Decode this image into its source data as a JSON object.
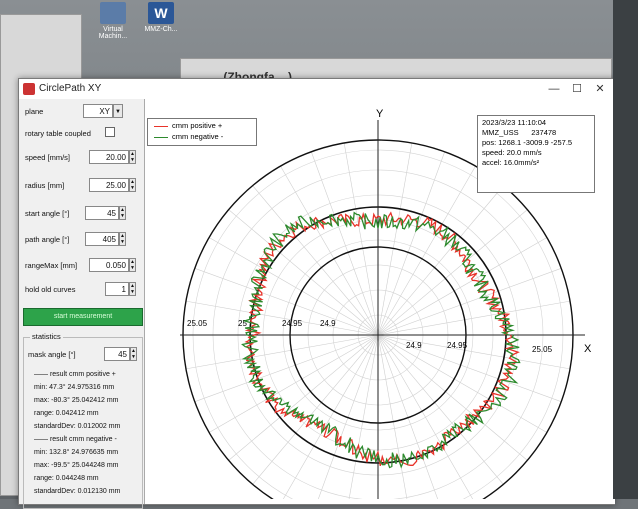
{
  "desktop": {
    "icons": [
      {
        "name": "Virtual Machin...",
        "color": "#5b7ca8"
      },
      {
        "name": "MMZ-Ch...",
        "color": "#2b5797"
      }
    ],
    "background_title": "... (Zhongfa ...)"
  },
  "window": {
    "title": "CirclePath XY",
    "minimize": "—",
    "maximize": "☐",
    "close": "✕"
  },
  "controls": {
    "plane_label": "plane",
    "plane_value": "XY",
    "rotary_label": "rotary table coupled",
    "speed_label": "speed [mm/s]",
    "speed_value": "20.00",
    "radius_label": "radius [mm]",
    "radius_value": "25.00",
    "start_angle_label": "start angle [°]",
    "start_angle_value": "45",
    "path_angle_label": "path angle [°]",
    "path_angle_value": "405",
    "range_max_label": "rangeMax [mm]",
    "range_max_value": "0.050",
    "hold_label": "hold old curves",
    "hold_value": "1",
    "start_button": "start measurement"
  },
  "statistics": {
    "title": "statistics",
    "mask_angle_label": "mask angle [°]",
    "mask_angle_value": "45",
    "positive_header": "—— result cmm positive +",
    "pos_min": "min: 47.3°   24.975316 mm",
    "pos_max": "max: -80.3°   25.042412 mm",
    "pos_range": "range: 0.042412 mm",
    "pos_std": "standardDev: 0.012002 mm",
    "negative_header": "—— result cmm negative -",
    "neg_min": "min: 132.8°   24.976635 mm",
    "neg_max": "max: -99.5°   25.044248 mm",
    "neg_range": "range: 0.044248 mm",
    "neg_std": "standardDev: 0.012130 mm"
  },
  "legend": {
    "positive": "cmm positive +",
    "negative": "cmm negative -",
    "positive_color": "#e8332a",
    "negative_color": "#2d8a2d"
  },
  "info": {
    "datetime": "2023/3/23 11:10:04",
    "machine": "MMZ_USS",
    "serial": "237478",
    "pos": "pos: 1268.1 -3009.9 -257.5",
    "speed": "speed: 20.0 mm/s",
    "accel": "accel: 16.0mm/s²"
  },
  "plot": {
    "y_axis_label": "Y",
    "x_axis_label": "X",
    "ring_labels": [
      "25.05",
      "25",
      "24.95",
      "24.9",
      "24.9",
      "24.95",
      "25.05"
    ]
  }
}
